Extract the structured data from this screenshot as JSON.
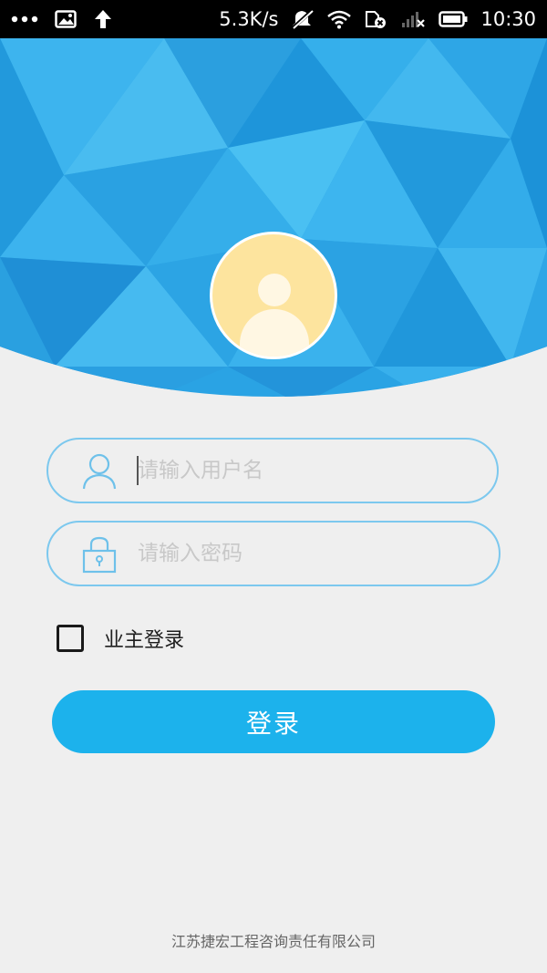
{
  "status_bar": {
    "network_speed": "5.3K/s",
    "time": "10:30",
    "icons": [
      "more-dots-icon",
      "image-icon",
      "upload-arrow-icon",
      "mute-icon",
      "wifi-icon",
      "sim-card-icon",
      "signal-icon",
      "battery-icon"
    ]
  },
  "colors": {
    "header_blue": "#2aa3e4",
    "accent": "#1cb2ec",
    "field_border": "#7cc8ee",
    "avatar": "#fde49e",
    "background": "#efefef"
  },
  "login": {
    "username": {
      "value": "",
      "placeholder": "请输入用户名",
      "icon": "user-icon"
    },
    "password": {
      "value": "",
      "placeholder": "请输入密码",
      "icon": "lock-icon"
    },
    "owner_login": {
      "label": "业主登录",
      "checked": false
    },
    "submit_label": "登录"
  },
  "footer": {
    "company": "江苏捷宏工程咨询责任有限公司"
  }
}
